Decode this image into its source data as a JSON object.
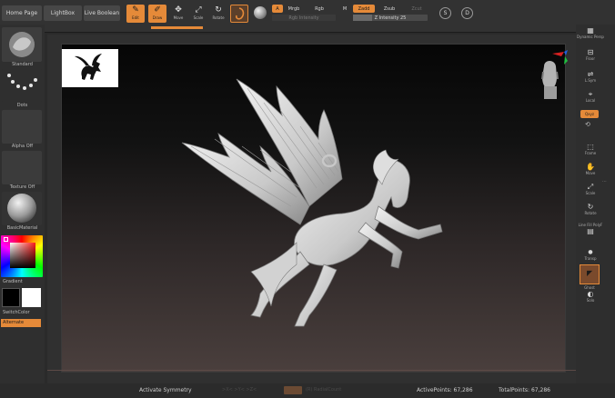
{
  "topbar": {
    "home_page": "Home Page",
    "lightbox": "LightBox",
    "live_boolean": "Live Boolean",
    "tools": [
      {
        "label": "Edit",
        "glyph": "✎",
        "active": true
      },
      {
        "label": "Draw",
        "glyph": "✐",
        "active": true
      },
      {
        "label": "Move",
        "glyph": "✥",
        "active": false
      },
      {
        "label": "Scale",
        "glyph": "⤢",
        "active": false
      },
      {
        "label": "Rotate",
        "glyph": "↻",
        "active": false
      }
    ],
    "a_label": "A",
    "mrgb": "Mrgb",
    "rgb": "Rgb",
    "rgb_intensity": "Rgb Intensity",
    "m_label": "M",
    "zadd": "Zadd",
    "zsub": "Zsub",
    "zcut": "Zcut",
    "z_intensity": "Z Intensity 25",
    "icon_s": "S",
    "icon_d": "D"
  },
  "left": {
    "standard": "Standard",
    "dots": "Dots",
    "alpha_off": "Alpha Off",
    "texture_off": "Texture Off",
    "basic_material": "BasicMaterial",
    "gradient": "Gradient",
    "switch_color": "SwitchColor",
    "alternate": "Alternate"
  },
  "right": {
    "items": [
      {
        "label": "Dynamic Persp",
        "glyph": "▦"
      },
      {
        "label": "Floor",
        "glyph": "⊟"
      },
      {
        "label": "L.Sym",
        "glyph": "⇌"
      },
      {
        "label": "Local",
        "glyph": "⌖"
      },
      {
        "label": "Qxyz",
        "glyph": ""
      },
      {
        "label": "Frame",
        "glyph": "⬚"
      },
      {
        "label": "Move",
        "glyph": "✋"
      },
      {
        "label": "Scale",
        "glyph": "⤢"
      },
      {
        "label": "Rotate",
        "glyph": "↻"
      },
      {
        "label": "Line Fill PolyF",
        "glyph": "▤"
      },
      {
        "label": "Transp",
        "glyph": "●"
      },
      {
        "label": "Solo",
        "glyph": "◐"
      }
    ],
    "ghost": "Ghost"
  },
  "bottombar": {
    "activate_symmetry": "Activate Symmetry",
    "active_points": "ActivePoints: 67,286",
    "total_points": "TotalPoints: 67,286"
  },
  "colors": {
    "accent": "#e58a39",
    "canvas_top": "#060606",
    "canvas_bottom": "#4a3f3d",
    "model": "#d8d8d8"
  }
}
